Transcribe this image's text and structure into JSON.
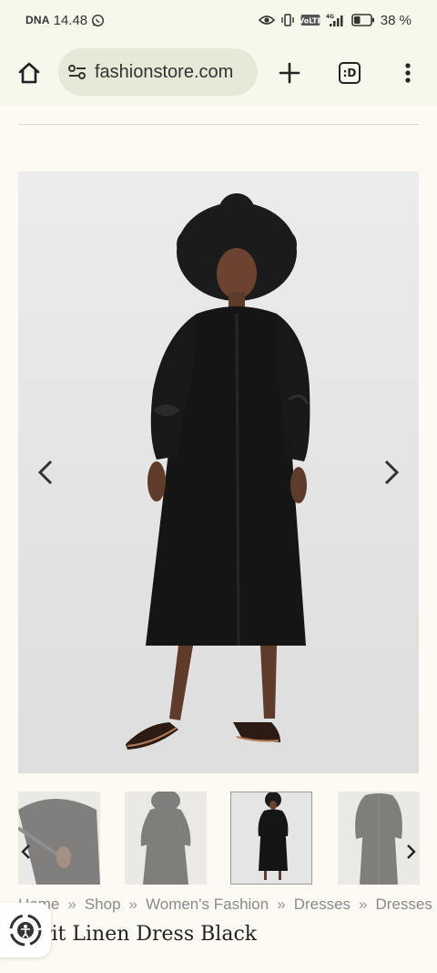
{
  "status_bar": {
    "carrier": "DNA",
    "time": "14.48",
    "volte": "VoLTE",
    "network": "4G",
    "battery": "38 %",
    "battery_level": 0.38
  },
  "browser": {
    "url": "fashionstore.com",
    "tab_count": ":D"
  },
  "gallery": {
    "main_alt": "Model wearing black linen dress",
    "thumbnails": [
      {
        "alt": "Sleeve detail",
        "state": "dim"
      },
      {
        "alt": "Back view",
        "state": "dim"
      },
      {
        "alt": "Front view",
        "state": "active"
      },
      {
        "alt": "Dress flat",
        "state": "dim"
      }
    ]
  },
  "breadcrumb": {
    "items": [
      "Home",
      "Shop",
      "Women's Fashion",
      "Dresses",
      "Dresses"
    ],
    "separator": "»"
  },
  "product": {
    "title": "rit Linen Dress Black"
  },
  "colors": {
    "chrome_bg": "#f6f8ec",
    "url_pill": "#e5e9d7",
    "page_bg": "#fdf9f3",
    "dress": "#151515"
  }
}
